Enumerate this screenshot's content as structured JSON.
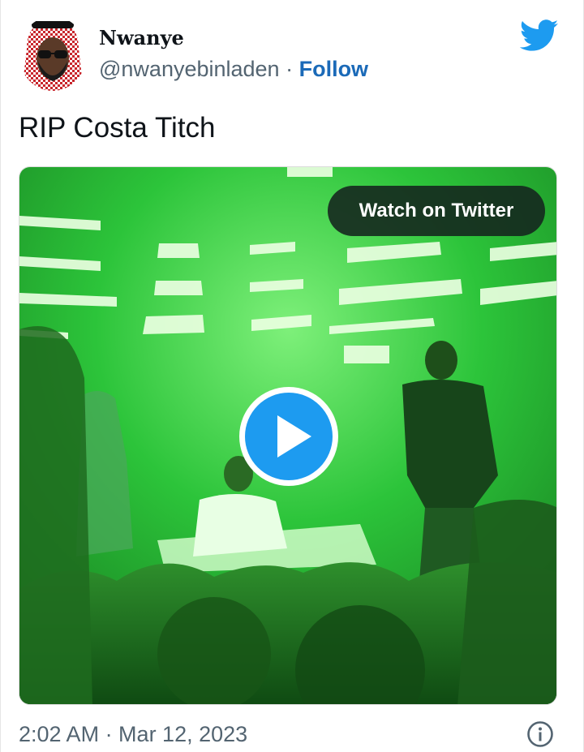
{
  "tweet": {
    "display_name": "Nwanye",
    "handle": "@nwanyebinladen",
    "separator": " · ",
    "follow_label": "Follow",
    "text": "RIP Costa Titch",
    "timestamp": "2:02 AM · Mar 12, 2023"
  },
  "media": {
    "watch_label": "Watch on Twitter",
    "play_icon": "play-icon"
  },
  "icons": {
    "brand": "twitter-bird-icon",
    "info": "info-icon"
  },
  "colors": {
    "twitter_blue": "#1d9bf0",
    "follow_link": "#1b6ab8",
    "secondary_text": "#536471",
    "stage_green": "#22c232"
  }
}
